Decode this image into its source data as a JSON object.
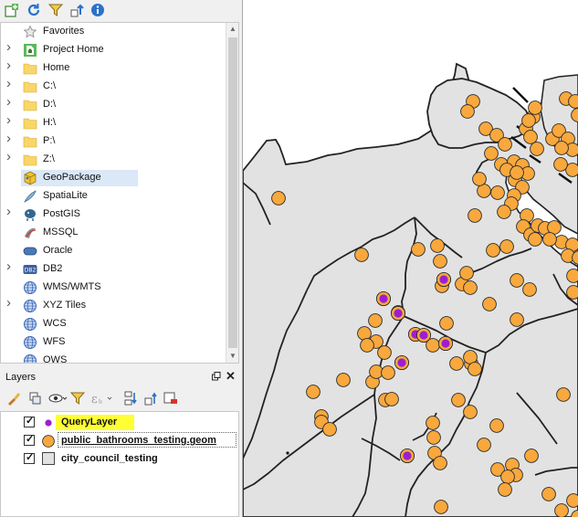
{
  "browser": {
    "toolbar": {
      "icons": [
        "add-layer-icon",
        "refresh-icon",
        "filter-icon",
        "collapse-all-icon",
        "info-icon"
      ]
    },
    "items": [
      {
        "label": "Favorites",
        "icon": "star-icon",
        "expandable": false
      },
      {
        "label": "Project Home",
        "icon": "project-home-icon",
        "expandable": true
      },
      {
        "label": "Home",
        "icon": "folder-icon",
        "expandable": true
      },
      {
        "label": "C:\\",
        "icon": "folder-icon",
        "expandable": true
      },
      {
        "label": "D:\\",
        "icon": "folder-icon",
        "expandable": true
      },
      {
        "label": "H:\\",
        "icon": "folder-icon",
        "expandable": true
      },
      {
        "label": "P:\\",
        "icon": "folder-icon",
        "expandable": true
      },
      {
        "label": "Z:\\",
        "icon": "folder-icon",
        "expandable": true
      },
      {
        "label": "GeoPackage",
        "icon": "geopackage-icon",
        "expandable": false,
        "selected": true
      },
      {
        "label": "SpatiaLite",
        "icon": "spatialite-icon",
        "expandable": false
      },
      {
        "label": "PostGIS",
        "icon": "postgis-icon",
        "expandable": true
      },
      {
        "label": "MSSQL",
        "icon": "mssql-icon",
        "expandable": false
      },
      {
        "label": "Oracle",
        "icon": "oracle-icon",
        "expandable": false
      },
      {
        "label": "DB2",
        "icon": "db2-icon",
        "expandable": true
      },
      {
        "label": "WMS/WMTS",
        "icon": "globe-icon",
        "expandable": false
      },
      {
        "label": "XYZ Tiles",
        "icon": "globe-icon",
        "expandable": true
      },
      {
        "label": "WCS",
        "icon": "globe-icon",
        "expandable": false
      },
      {
        "label": "WFS",
        "icon": "globe-icon",
        "expandable": false
      },
      {
        "label": "OWS",
        "icon": "globe-icon",
        "expandable": false
      }
    ]
  },
  "layers_panel": {
    "title": "Layers",
    "toolbar": {
      "icons": [
        "style-icon",
        "add-group-icon",
        "visibility-icon",
        "filter-legend-icon",
        "expression-filter-icon",
        "expand-all-icon",
        "collapse-all-icon",
        "remove-layer-icon"
      ]
    },
    "layers": [
      {
        "name": "QueryLayer",
        "checked": true,
        "symbol": "point",
        "color": "#9b1fd1",
        "highlighted": true
      },
      {
        "name": "public_bathrooms_testing.geom",
        "checked": true,
        "symbol": "point",
        "color": "#f8a83c",
        "underline": true
      },
      {
        "name": "city_council_testing",
        "checked": true,
        "symbol": "polygon",
        "color": "#e2e2e2"
      }
    ]
  },
  "map": {
    "polygon_fill": "#e2e2e2",
    "polygon_stroke": "#222222",
    "bathroom_color": "#f8a83c",
    "query_color": "#9b1fd1",
    "highlight_color": "#ffff33"
  }
}
